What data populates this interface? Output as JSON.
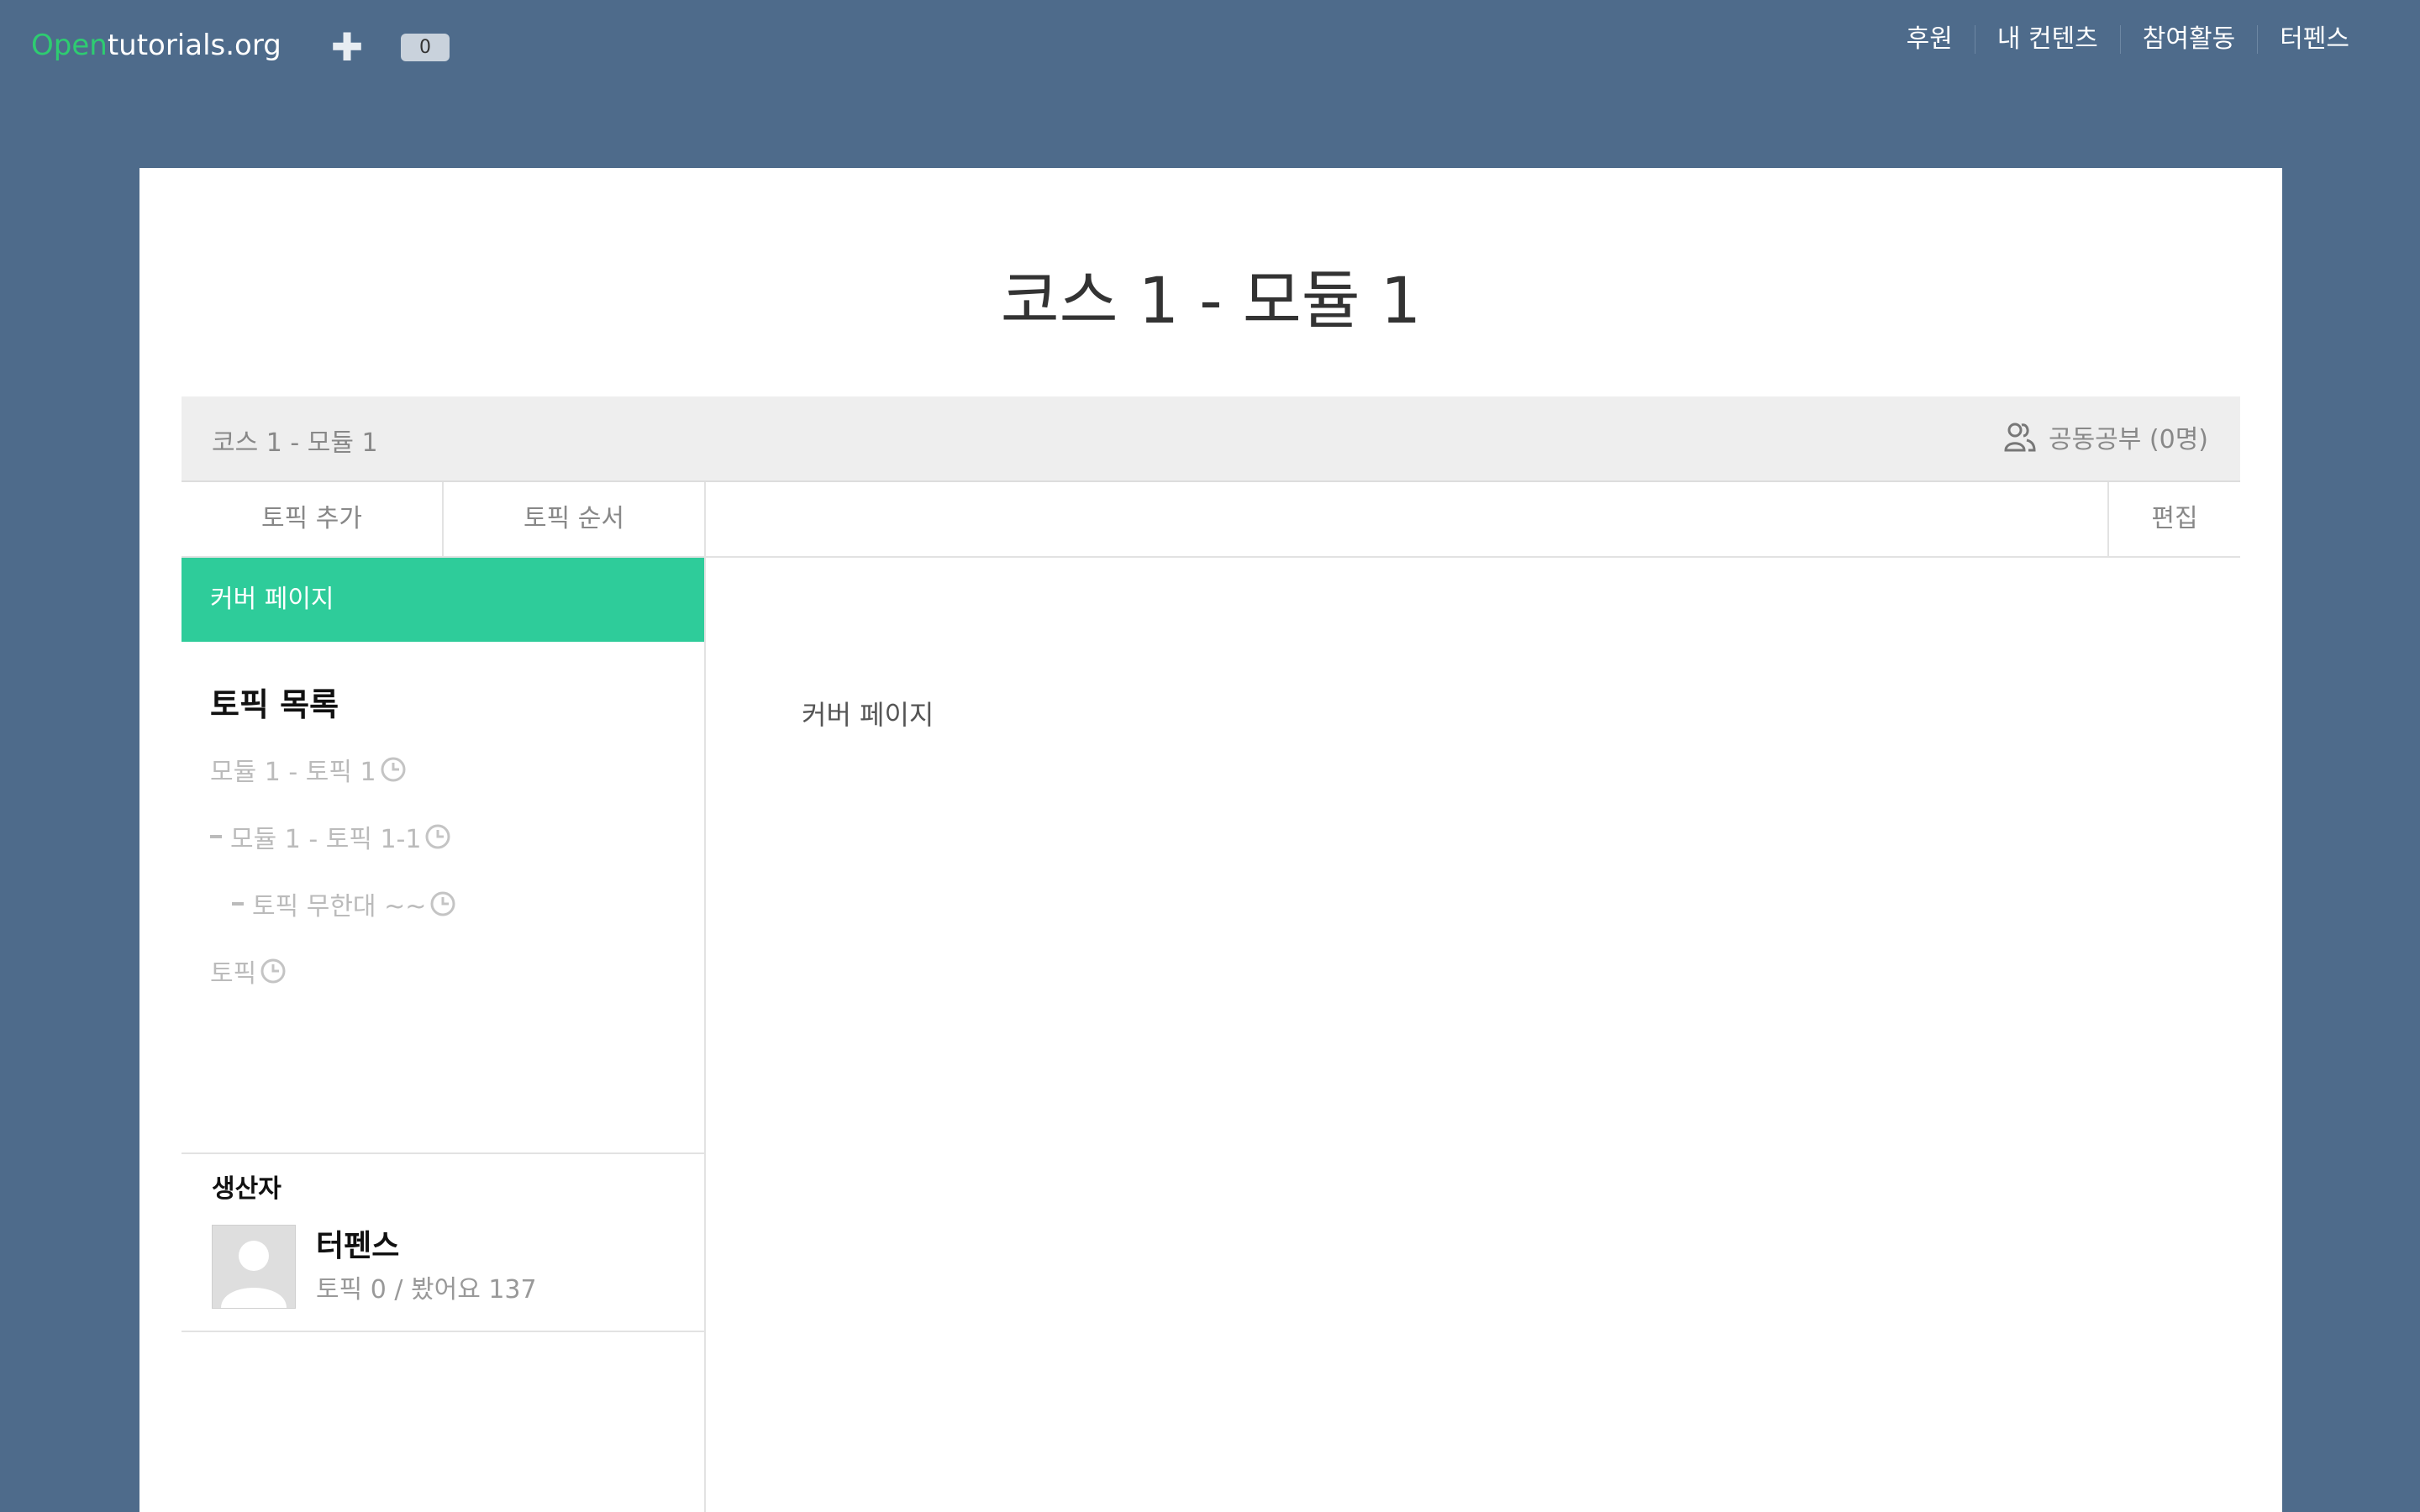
{
  "header": {
    "logo_open": "Open",
    "logo_rest": "tutorials.org",
    "counter": "0",
    "nav": [
      "후원",
      "내 컨텐츠",
      "참여활동",
      "터펜스"
    ]
  },
  "page": {
    "title": "코스 1 - 모듈 1",
    "breadcrumb": "코스 1 - 모듈 1",
    "study_label": "공동공부 (0명)"
  },
  "tabs": {
    "add_topic": "토픽 추가",
    "topic_order": "토픽 순서",
    "edit": "편집"
  },
  "sidebar": {
    "cover_label": "커버 페이지",
    "topics_heading": "토픽 목록",
    "topics": [
      "모듈 1 - 토픽 1",
      "모듈 1 - 토픽 1-1",
      "토픽 무한대 ~~",
      "토픽"
    ]
  },
  "creator": {
    "heading": "생산자",
    "name": "터펜스",
    "stats": "토픽 0  /  봤어요 137"
  },
  "content": {
    "text": "커버 페이지"
  },
  "colors": {
    "background": "#4e6b8b",
    "accent": "#2ecc9a",
    "logo_green": "#2ecc71"
  }
}
